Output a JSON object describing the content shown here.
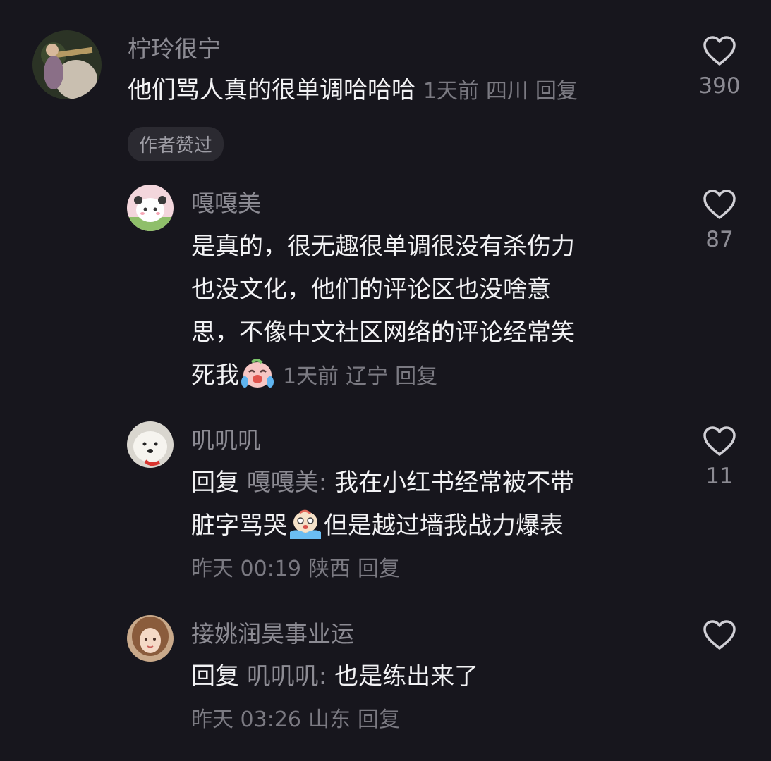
{
  "comments": [
    {
      "username": "柠玲很宁",
      "text": "他们骂人真的很单调哈哈哈",
      "time": "1天前",
      "location": "四川",
      "reply_label": "回复",
      "likes": "390",
      "badge": "作者赞过"
    },
    {
      "username": "嘎嘎美",
      "text_line1": "是真的，很无趣很单调很没有杀伤力",
      "text_line2": "也没文化，他们的评论区也没啥意",
      "text_line3": "思，不像中文社区网络的评论经常笑",
      "text_line4": "死我",
      "emoji": "crying-laughing-emoji",
      "time": "1天前",
      "location": "辽宁",
      "reply_label": "回复",
      "likes": "87"
    },
    {
      "username": "叽叽叽",
      "reply_prefix": "回复",
      "reply_to": "嘎嘎美:",
      "text_line1": "我在小红书经常被不带",
      "text_line2a": "脏字骂哭",
      "emoji": "crying-tears-emoji",
      "text_line2b": "但是越过墙我战力爆表",
      "time": "昨天 00:19",
      "location": "陕西",
      "reply_label": "回复",
      "likes": "11"
    },
    {
      "username": "接姚润昊事业运",
      "reply_prefix": "回复",
      "reply_to": "叽叽叽:",
      "text": "也是练出来了",
      "time": "昨天 03:26",
      "location": "山东",
      "reply_label": "回复",
      "likes": ""
    }
  ],
  "colors": {
    "background": "#17161d",
    "username": "#8c8b93",
    "meta": "#7b7a82",
    "text": "#f2f2f4"
  }
}
